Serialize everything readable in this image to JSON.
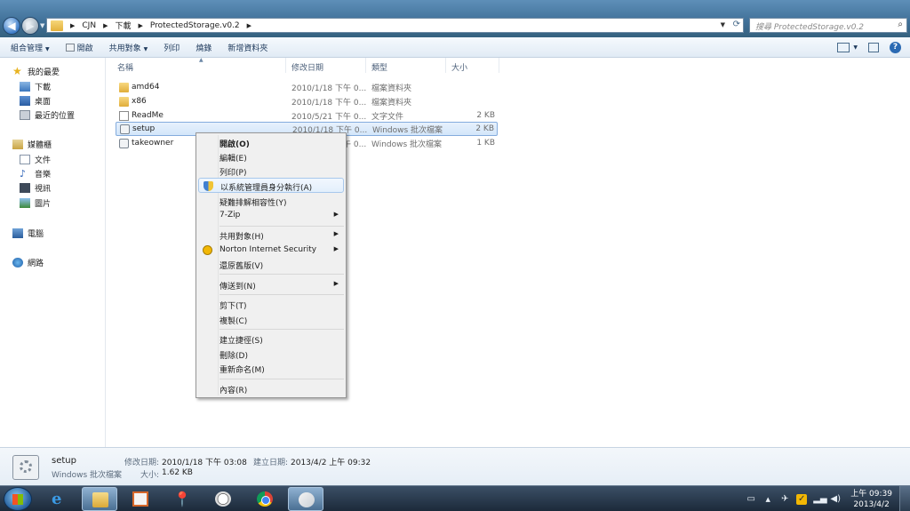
{
  "address": {
    "crumbs": [
      "CJN",
      "下載",
      "ProtectedStorage.v0.2"
    ]
  },
  "search": {
    "placeholder": "搜尋 ProtectedStorage.v0.2"
  },
  "toolbar": {
    "organize": "組合管理",
    "open": "開啟",
    "share": "共用對象",
    "print": "列印",
    "burn": "燒錄",
    "new_folder": "新增資料夾"
  },
  "sidebar": {
    "favorites": "我的最愛",
    "downloads": "下載",
    "desktop": "桌面",
    "recent": "最近的位置",
    "libraries": "媒體櫃",
    "documents": "文件",
    "music": "音樂",
    "videos": "視訊",
    "pictures": "圖片",
    "computer": "電腦",
    "network": "網路"
  },
  "columns": {
    "name": "名稱",
    "date": "修改日期",
    "type": "類型",
    "size": "大小"
  },
  "files": [
    {
      "name": "amd64",
      "date": "2010/1/18 下午 0...",
      "type": "檔案資料夾",
      "size": "",
      "icon": "folder-icon"
    },
    {
      "name": "x86",
      "date": "2010/1/18 下午 0...",
      "type": "檔案資料夾",
      "size": "",
      "icon": "folder-icon"
    },
    {
      "name": "ReadMe",
      "date": "2010/5/21 下午 0...",
      "type": "文字文件",
      "size": "2 KB",
      "icon": "text-file-icon"
    },
    {
      "name": "setup",
      "date": "2010/1/18 下午 0...",
      "type": "Windows 批次檔案",
      "size": "2 KB",
      "icon": "batch-file-icon"
    },
    {
      "name": "takeowner",
      "date": "2010/1/18 下午 0...",
      "type": "Windows 批次檔案",
      "size": "1 KB",
      "icon": "batch-file-icon"
    }
  ],
  "context_menu": {
    "open": "開啟(O)",
    "edit": "編輯(E)",
    "print": "列印(P)",
    "run_as_admin": "以系統管理員身分執行(A)",
    "troubleshoot": "疑難排解相容性(Y)",
    "zip": "7-Zip",
    "share": "共用對象(H)",
    "norton": "Norton Internet Security",
    "restore": "還原舊版(V)",
    "send_to": "傳送到(N)",
    "cut": "剪下(T)",
    "copy": "複製(C)",
    "shortcut": "建立捷徑(S)",
    "delete": "刪除(D)",
    "rename": "重新命名(M)",
    "properties": "內容(R)"
  },
  "details": {
    "name": "setup",
    "type": "Windows 批次檔案",
    "modified_label": "修改日期:",
    "modified_value": "2010/1/18 下午 03:08",
    "created_label": "建立日期:",
    "created_value": "2013/4/2 上午 09:32",
    "size_label": "大小:",
    "size_value": "1.62 KB"
  },
  "taskbar": {
    "time": "上午 09:39",
    "date": "2013/4/2"
  }
}
